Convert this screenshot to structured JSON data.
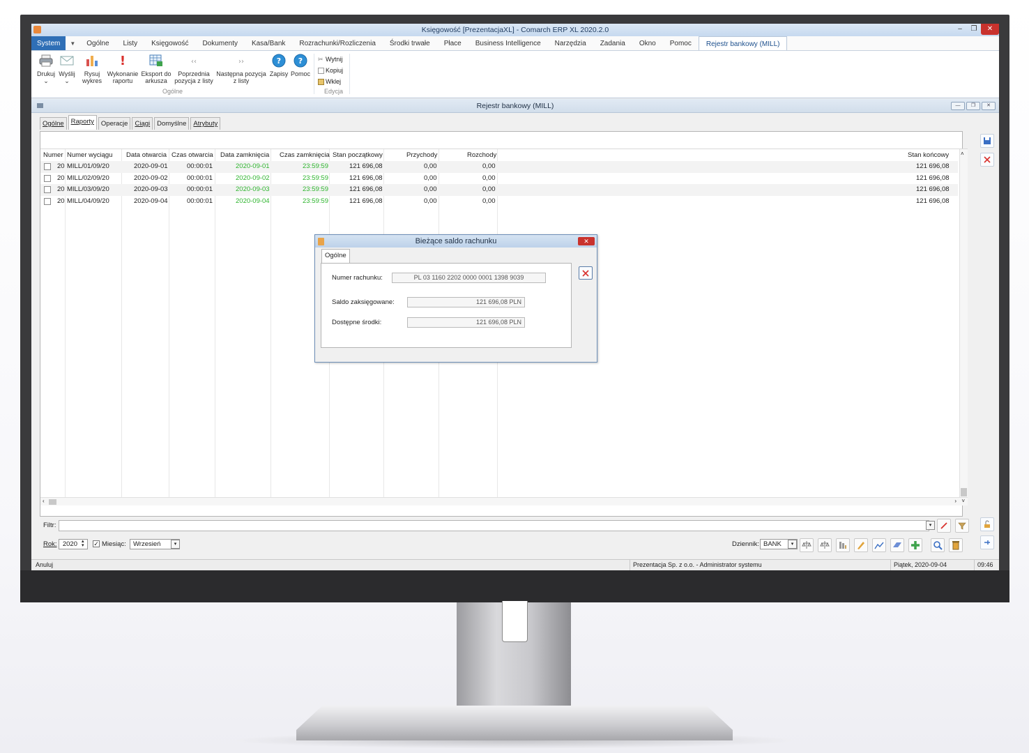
{
  "app": {
    "title": "Księgowość [PrezentacjaXL] - Comarch ERP XL 2020.2.0"
  },
  "menu": {
    "items": [
      "System",
      "Ogólne",
      "Listy",
      "Księgowość",
      "Dokumenty",
      "Kasa/Bank",
      "Rozrachunki/Rozliczenia",
      "Środki trwałe",
      "Płace",
      "Business Intelligence",
      "Narzędzia",
      "Zadania",
      "Okno",
      "Pomoc",
      "Rejestr bankowy (MILL)"
    ],
    "active": "Rejestr bankowy (MILL)"
  },
  "ribbon": {
    "print": "Drukuj",
    "send": "Wyślij",
    "chart": "Rysuj wykres",
    "report": "Wykonanie raportu",
    "export": "Eksport do arkusza",
    "prev": "Poprzednia pozycja z listy",
    "next": "Następna pozycja z listy",
    "save": "Zapisy",
    "help": "Pomoc",
    "group_general": "Ogólne",
    "cut": "Wytnij",
    "copy": "Kopiuj",
    "paste": "Wklej",
    "group_edit": "Edycja"
  },
  "window": {
    "title": "Rejestr bankowy (MILL)",
    "tabs": [
      "Ogólne",
      "Raporty",
      "Operacje",
      "Ciągi",
      "Domyślne",
      "Atrybuty"
    ],
    "active_tab": "Raporty"
  },
  "table": {
    "headers": [
      "Numer",
      "Numer wyciągu",
      "Data otwarcia",
      "Czas otwarcia",
      "Data zamknięcia",
      "Czas zamknięcia",
      "Stan początkowy",
      "Przychody",
      "Rozchody",
      "Stan końcowy"
    ],
    "rows": [
      {
        "num": "20",
        "statement": "MILL/01/09/20",
        "open_date": "2020-09-01",
        "open_time": "00:00:01",
        "close_date": "2020-09-01",
        "close_time": "23:59:59",
        "start": "121 696,08",
        "income": "0,00",
        "expense": "0,00",
        "end": "121 696,08"
      },
      {
        "num": "20",
        "statement": "MILL/02/09/20",
        "open_date": "2020-09-02",
        "open_time": "00:00:01",
        "close_date": "2020-09-02",
        "close_time": "23:59:59",
        "start": "121 696,08",
        "income": "0,00",
        "expense": "0,00",
        "end": "121 696,08"
      },
      {
        "num": "20",
        "statement": "MILL/03/09/20",
        "open_date": "2020-09-03",
        "open_time": "00:00:01",
        "close_date": "2020-09-03",
        "close_time": "23:59:59",
        "start": "121 696,08",
        "income": "0,00",
        "expense": "0,00",
        "end": "121 696,08"
      },
      {
        "num": "20",
        "statement": "MILL/04/09/20",
        "open_date": "2020-09-04",
        "open_time": "00:00:01",
        "close_date": "2020-09-04",
        "close_time": "23:59:59",
        "start": "121 696,08",
        "income": "0,00",
        "expense": "0,00",
        "end": "121 696,08"
      }
    ]
  },
  "filter": {
    "label": "Filtr:",
    "value": ""
  },
  "bottom": {
    "year_label": "Rok:",
    "year": "2020",
    "month_label": "Miesiąc:",
    "month": "Wrzesień",
    "journal_label": "Dziennik:",
    "journal": "BANK"
  },
  "status": {
    "left": "Anuluj",
    "company": "Prezentacja Sp. z o.o. - Administrator systemu",
    "date": "Piątek, 2020-09-04",
    "time": "09:46"
  },
  "dialog": {
    "title": "Bieżące saldo rachunku",
    "tab": "Ogólne",
    "account_label": "Numer rachunku:",
    "account": "PL 03 1160 2202 0000 0001 1398 9039",
    "posted_label": "Saldo zaksięgowane:",
    "posted": "121 696,08 PLN",
    "available_label": "Dostępne środki:",
    "available": "121 696,08 PLN"
  },
  "colors": {
    "accent": "#2f6fb6",
    "close_red": "#c9322d",
    "closed_green": "#2fb52f"
  }
}
